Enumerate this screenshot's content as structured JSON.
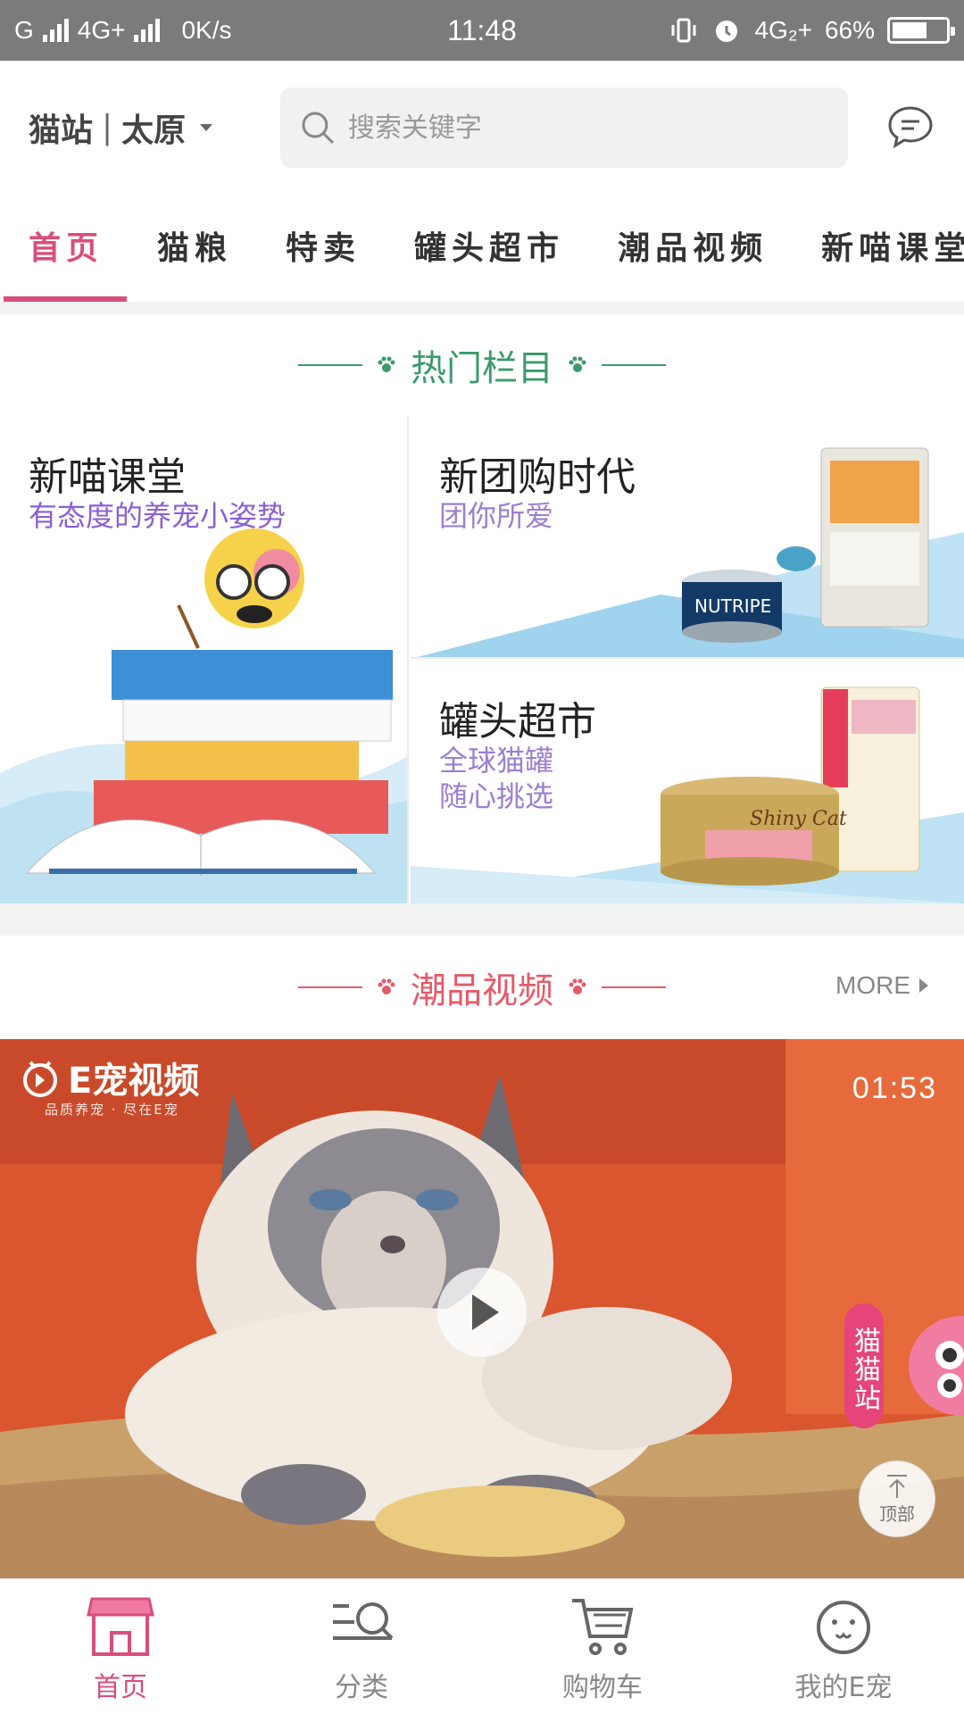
{
  "status_bar": {
    "carrier_left": "G",
    "network": "4G+",
    "speed": "0K/s",
    "time": "11:48",
    "network_right": "4G₂+",
    "battery": "66%"
  },
  "header": {
    "site": "猫站",
    "city": "太原",
    "search_placeholder": "搜索关键字"
  },
  "tabs": [
    "首页",
    "猫粮",
    "特卖",
    "罐头超市",
    "潮品视频",
    "新喵课堂"
  ],
  "active_tab": 0,
  "hot_section": {
    "title": "热门栏目",
    "cards": [
      {
        "title": "新喵课堂",
        "subtitle": "有态度的养宠小姿势"
      },
      {
        "title": "新团购时代",
        "subtitle": "团你所爱"
      },
      {
        "title": "罐头超市",
        "subtitle_line1": "全球猫罐",
        "subtitle_line2": "随心挑选"
      }
    ]
  },
  "trend_section": {
    "title": "潮品视频",
    "more": "MORE"
  },
  "video": {
    "logo": "E宠视频",
    "logo_sub": "品质养宠 · 尽在E宠",
    "duration": "01:53"
  },
  "floating": {
    "tag": "猫猫站",
    "to_top": "顶部"
  },
  "bottom_nav": [
    {
      "label": "首页",
      "icon": "shop-icon",
      "active": true
    },
    {
      "label": "分类",
      "icon": "category-search-icon",
      "active": false
    },
    {
      "label": "购物车",
      "icon": "cart-icon",
      "active": false
    },
    {
      "label": "我的E宠",
      "icon": "profile-face-icon",
      "active": false
    }
  ],
  "colors": {
    "accent": "#d94e7d",
    "hot_green": "#3b9a6c",
    "trend_red": "#e65a68",
    "subtitle_purple": "#8a5fd6"
  }
}
